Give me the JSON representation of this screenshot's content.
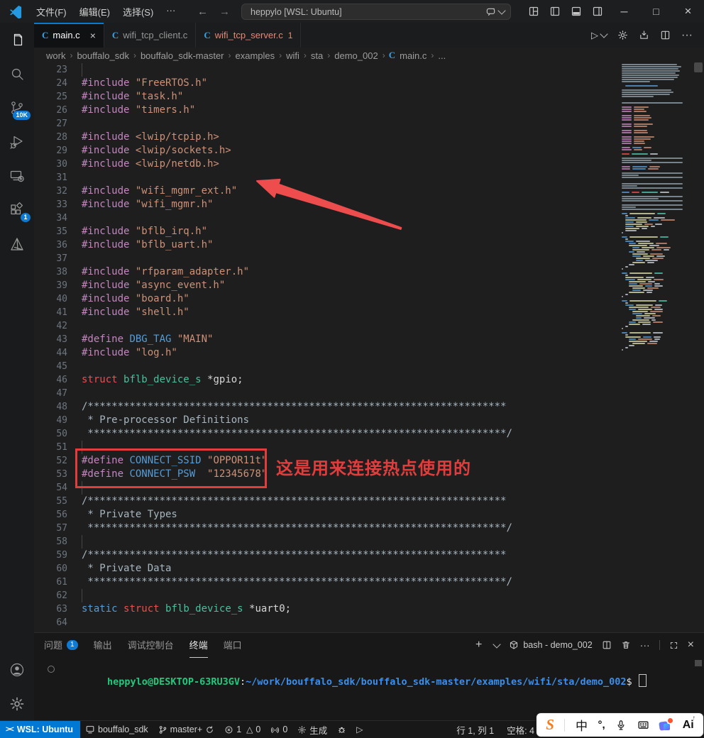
{
  "colors": {
    "accent": "#0078d4",
    "tab_active_border": "#0a7ad1",
    "error_tab": "#ef8576",
    "annotation_red": "#e23d3d",
    "prompt_green": "#23c87d",
    "prompt_blue": "#3b8eea"
  },
  "icons": {
    "back": "←",
    "forward": "→",
    "minimize": "─",
    "maximize": "□",
    "close": "×",
    "more": "···",
    "warning": "△",
    "play": "▷",
    "plus": "＋",
    "remote": "><",
    "c_file": "C",
    "dot_sep": "›"
  },
  "titlebar": {
    "title": "heppylo [WSL: Ubuntu]",
    "menus": [
      {
        "id": "file",
        "label": "文件(F)"
      },
      {
        "id": "edit",
        "label": "编辑(E)"
      },
      {
        "id": "selection",
        "label": "选择(S)"
      },
      {
        "id": "more",
        "label": "···"
      }
    ]
  },
  "tabs": [
    {
      "label": "main.c",
      "active": true,
      "close": "×"
    },
    {
      "label": "wifi_tcp_client.c"
    },
    {
      "label": "wifi_tcp_server.c",
      "badge": "1",
      "err": true
    }
  ],
  "breadcrumb": [
    "work",
    "bouffalo_sdk",
    "bouffalo_sdk-master",
    "examples",
    "wifi",
    "sta",
    "demo_002",
    "main.c",
    "..."
  ],
  "activity": {
    "scm_badge": "10K",
    "ext_badge": "1"
  },
  "editor": {
    "lines": [
      {
        "n": 23,
        "g": 1,
        "t": []
      },
      {
        "n": 24,
        "t": [
          [
            "p",
            "#include "
          ],
          [
            "s",
            "\"FreeRTOS.h\""
          ]
        ]
      },
      {
        "n": 25,
        "t": [
          [
            "p",
            "#include "
          ],
          [
            "s",
            "\"task.h\""
          ]
        ]
      },
      {
        "n": 26,
        "t": [
          [
            "p",
            "#include "
          ],
          [
            "s",
            "\"timers.h\""
          ]
        ]
      },
      {
        "n": 27,
        "t": []
      },
      {
        "n": 28,
        "t": [
          [
            "p",
            "#include "
          ],
          [
            "s",
            "<lwip/tcpip.h>"
          ]
        ]
      },
      {
        "n": 29,
        "t": [
          [
            "p",
            "#include "
          ],
          [
            "s",
            "<lwip/sockets.h>"
          ]
        ]
      },
      {
        "n": 30,
        "t": [
          [
            "p",
            "#include "
          ],
          [
            "s",
            "<lwip/netdb.h>"
          ]
        ]
      },
      {
        "n": 31,
        "t": []
      },
      {
        "n": 32,
        "t": [
          [
            "p",
            "#include "
          ],
          [
            "s",
            "\"wifi_mgmr_ext.h\""
          ]
        ]
      },
      {
        "n": 33,
        "t": [
          [
            "p",
            "#include "
          ],
          [
            "s",
            "\"wifi_mgmr.h\""
          ]
        ]
      },
      {
        "n": 34,
        "t": []
      },
      {
        "n": 35,
        "t": [
          [
            "p",
            "#include "
          ],
          [
            "s",
            "\"bflb_irq.h\""
          ]
        ]
      },
      {
        "n": 36,
        "t": [
          [
            "p",
            "#include "
          ],
          [
            "s",
            "\"bflb_uart.h\""
          ]
        ]
      },
      {
        "n": 37,
        "t": []
      },
      {
        "n": 38,
        "t": [
          [
            "p",
            "#include "
          ],
          [
            "s",
            "\"rfparam_adapter.h\""
          ]
        ]
      },
      {
        "n": 39,
        "t": [
          [
            "p",
            "#include "
          ],
          [
            "s",
            "\"async_event.h\""
          ]
        ]
      },
      {
        "n": 40,
        "t": [
          [
            "p",
            "#include "
          ],
          [
            "s",
            "\"board.h\""
          ]
        ]
      },
      {
        "n": 41,
        "t": [
          [
            "p",
            "#include "
          ],
          [
            "s",
            "\"shell.h\""
          ]
        ]
      },
      {
        "n": 42,
        "t": []
      },
      {
        "n": 43,
        "t": [
          [
            "p",
            "#define "
          ],
          [
            "k",
            "DBG_TAG "
          ],
          [
            "s",
            "\"MAIN\""
          ]
        ]
      },
      {
        "n": 44,
        "t": [
          [
            "p",
            "#include "
          ],
          [
            "s",
            "\"log.h\""
          ]
        ]
      },
      {
        "n": 45,
        "t": []
      },
      {
        "n": 46,
        "t": [
          [
            "r",
            "struct "
          ],
          [
            "t",
            "bflb_device_s "
          ],
          [
            "w",
            "*gpio;"
          ]
        ]
      },
      {
        "n": 47,
        "t": []
      },
      {
        "n": 48,
        "t": [
          [
            "c",
            "/**********************************************************************"
          ]
        ]
      },
      {
        "n": 49,
        "t": [
          [
            "c",
            " * Pre-processor Definitions"
          ]
        ]
      },
      {
        "n": 50,
        "t": [
          [
            "c",
            " **********************************************************************/"
          ]
        ]
      },
      {
        "n": 51,
        "g": 1,
        "t": []
      },
      {
        "n": 52,
        "t": [
          [
            "p",
            "#define "
          ],
          [
            "k",
            "CONNECT_SSID "
          ],
          [
            "s",
            "\"OPPOR11t\""
          ]
        ]
      },
      {
        "n": 53,
        "t": [
          [
            "p",
            "#define "
          ],
          [
            "k",
            "CONNECT_PSW  "
          ],
          [
            "s",
            "\"12345678\""
          ]
        ]
      },
      {
        "n": 54,
        "g": 1,
        "t": []
      },
      {
        "n": 55,
        "t": [
          [
            "c",
            "/**********************************************************************"
          ]
        ]
      },
      {
        "n": 56,
        "t": [
          [
            "c",
            " * Private Types"
          ]
        ]
      },
      {
        "n": 57,
        "t": [
          [
            "c",
            " **********************************************************************/"
          ]
        ]
      },
      {
        "n": 58,
        "g": 1,
        "t": []
      },
      {
        "n": 59,
        "t": [
          [
            "c",
            "/**********************************************************************"
          ]
        ]
      },
      {
        "n": 60,
        "t": [
          [
            "c",
            " * Private Data"
          ]
        ]
      },
      {
        "n": 61,
        "t": [
          [
            "c",
            " **********************************************************************/"
          ]
        ]
      },
      {
        "n": 62,
        "g": 1,
        "t": []
      },
      {
        "n": 63,
        "t": [
          [
            "k",
            "static "
          ],
          [
            "r",
            "struct "
          ],
          [
            "t",
            "bflb_device_s "
          ],
          [
            "w",
            "*uart0;"
          ]
        ]
      },
      {
        "n": 64,
        "t": []
      }
    ]
  },
  "annotations": {
    "label": "这是用来连接热点使用的"
  },
  "minimap": {
    "rows": [
      "c78",
      "c84",
      "c80",
      "c82",
      "c76",
      "c81",
      "c79",
      "c74",
      "c40",
      "",
      ">b46",
      "",
      "c70",
      "c73",
      "c68",
      "c45",
      "",
      "",
      "c86",
      "",
      "m14 o21",
      "m14 o15",
      "m14 o18",
      "",
      "m14 o23",
      "m14 o25",
      "m14 o21",
      "",
      "m14 o27",
      "m14 o19",
      "",
      "m14 o19",
      "m14 o20",
      "",
      "m14 o29",
      "m14 o24",
      "m14 o15",
      "m14 o16",
      "",
      "m12 b13 o11",
      "m14 o12",
      "",
      "r11 t23 w11",
      "",
      "c86",
      "c42",
      "c86",
      "",
      "m12 b21 o15",
      "m12 b19 o15",
      "",
      "c86",
      "c24",
      "c86",
      "",
      "",
      "c86",
      "c22",
      "c86",
      "",
      "b11 r11 t23 w13",
      "",
      "c86",
      "c52",
      "c86",
      "",
      "c86",
      "c20",
      "c86",
      "",
      "b8 y36 t12",
      ">w4",
      ">b14 y20 w16",
      ">y30 b14 o20",
      ">b12 y16",
      ">y24 o12 w10",
      ">b12 y18 w6",
      ">y20 w8",
      ">w16",
      "w2",
      "",
      "b8 y40 t12",
      ">w4",
      ">b12 w20",
      ">>b10 y22 o16",
      ">>y26 w14",
      ">>>b10 y18 o20",
      ">>>y24 o14 w8",
      ">>b8 w12",
      ">>>y22 o18",
      ">>>b12 y16 w12",
      ">>>>y20 o16",
      ">>>>b10 w18",
      ">>>y18 w10",
      ">>w8",
      ">w4",
      "w2",
      "",
      "b8 y32 t12",
      ">w4",
      ">y26 w12",
      ">b14 y20 o14",
      ">>y24 w10",
      ">>b12 o18 w8",
      ">>y20 b10 w12",
      ">>>y18 o16",
      ">>>b12 w14",
      ">>y22 w8",
      ">w4",
      "w2",
      "",
      "b8 y38 t12",
      ">w4",
      ">b12 y24 w10",
      ">>y28 o14",
      ">>b10 y20 w12",
      ">>>y22 o18",
      ">>>b14 y16",
      ">>>>y20 o12",
      ">>>>b8 w16",
      ">>>y24 w6",
      ">>b10 y18 o14",
      ">>y16 w12",
      ">w4",
      "w2",
      "",
      "b8 y30 w14",
      ">w4",
      ">y22 b12 w10",
      ">>b10 o20 w8",
      ">>y26 w12",
      ">>>y18 o14",
      ">>w8",
      ">w4",
      "w2"
    ]
  },
  "panel": {
    "tabs": [
      {
        "label": "问题",
        "badge": "1"
      },
      {
        "label": "输出"
      },
      {
        "label": "调试控制台"
      },
      {
        "label": "终端",
        "active": true
      },
      {
        "label": "端口"
      }
    ],
    "shell_label": "bash - demo_002"
  },
  "terminal": {
    "user": "heppylo@DESKTOP-63RU3GV",
    "colon": ":",
    "path": "~/work/bouffalo_sdk/bouffalo_sdk-master/examples/wifi/sta/demo_002",
    "dollar": "$"
  },
  "statusbar": {
    "remote": "WSL: Ubuntu",
    "workspace": "bouffalo_sdk",
    "branch": "master+",
    "errors": "1",
    "warnings": "0",
    "ports": "0",
    "build": "生成",
    "line_col": "行 1, 列 1",
    "spaces": "空格: 4"
  },
  "ime": {
    "logo": "S",
    "lang": "中",
    "punct": "°,",
    "ai": "Ai"
  }
}
